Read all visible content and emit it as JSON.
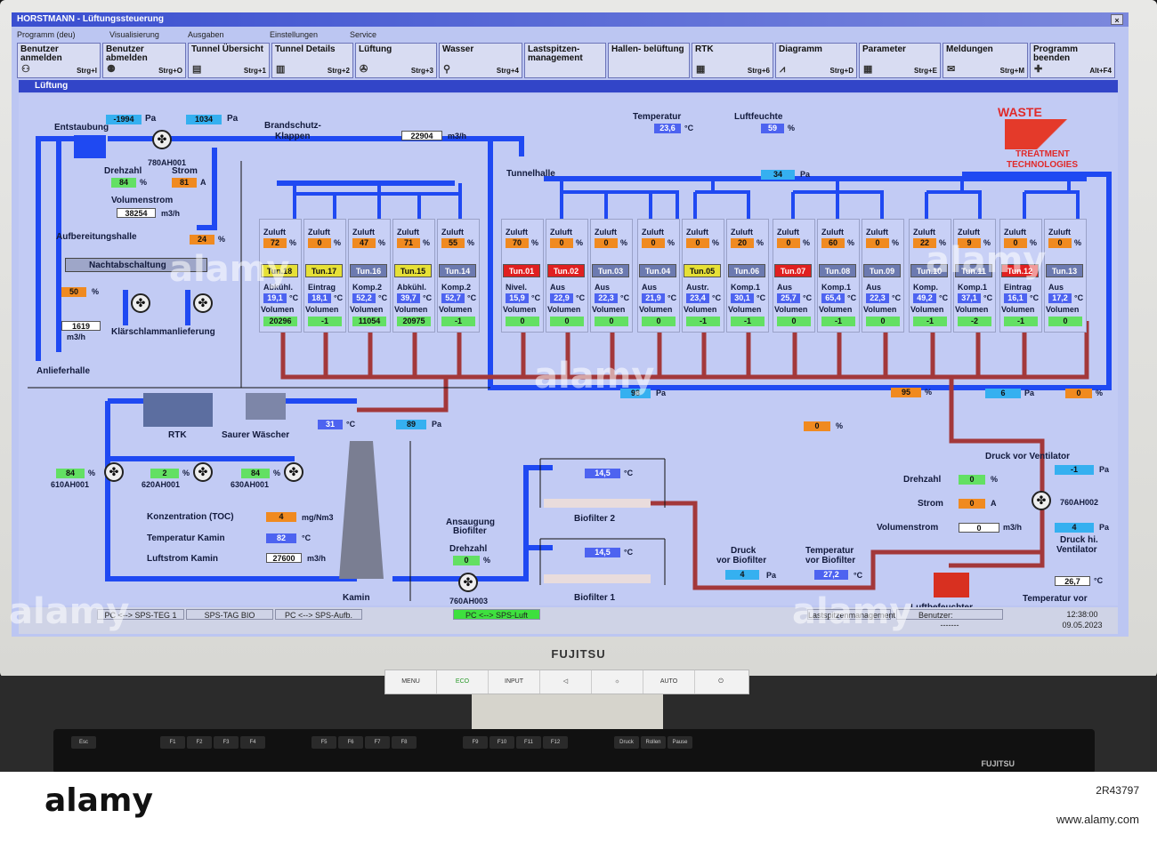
{
  "window": {
    "title": "HORSTMANN - Lüftungssteuerung",
    "close_symbol": "×"
  },
  "menu": [
    "Programm (deu)",
    "Visualisierung",
    "Ausgaben",
    "Einstellungen",
    "Service"
  ],
  "toolbar": [
    {
      "label": "Benutzer anmelden",
      "hotkey": "Strg+I"
    },
    {
      "label": "Benutzer abmelden",
      "hotkey": "Strg+O"
    },
    {
      "label": "Tunnel Übersicht",
      "hotkey": "Strg+1"
    },
    {
      "label": "Tunnel Details",
      "hotkey": "Strg+2"
    },
    {
      "label": "Lüftung",
      "hotkey": "Strg+3"
    },
    {
      "label": "Wasser",
      "hotkey": "Strg+4"
    },
    {
      "label": "Lastspitzen- management",
      "hotkey": ""
    },
    {
      "label": "Hallen- belüftung",
      "hotkey": ""
    },
    {
      "label": "RTK",
      "hotkey": "Strg+6"
    },
    {
      "label": "Diagramm",
      "hotkey": "Strg+D"
    },
    {
      "label": "Parameter",
      "hotkey": "Strg+E"
    },
    {
      "label": "Meldungen",
      "hotkey": "Strg+M"
    },
    {
      "label": "Programm beenden",
      "hotkey": "Alt+F4"
    }
  ],
  "section": "Lüftung",
  "logo": {
    "name": "WASTE",
    "line1": "TREATMENT",
    "line2": "TECHNOLOGIES"
  },
  "left": {
    "p1": "-1994",
    "p2": "1034",
    "pa": "Pa",
    "entstaubung": "Entstaubung",
    "fan": "780AH001",
    "drehzahl": "Drehzahl",
    "strom": "Strom",
    "drehzahl_val": "84",
    "strom_val": "81",
    "pct": "%",
    "amp": "A",
    "volumenstrom": "Volumenstrom",
    "vol_val": "38254",
    "m3h": "m3/h",
    "aufbereitung": "Aufbereitungshalle",
    "auf_val": "24",
    "nacht": "Nachtabschaltung",
    "v50": "50",
    "v1619": "1619",
    "klaer": "Klärschlammanlieferung",
    "anliefer": "Anlieferhalle"
  },
  "top": {
    "brand": "Brandschutz-",
    "klappen": "Klappen",
    "flow": "22904",
    "m3h": "m3/h",
    "tunnelhalle": "Tunnelhalle",
    "temp_label": "Temperatur",
    "temp_val": "23,6",
    "degc": "°C",
    "hum_label": "Luftfeuchte",
    "hum_val": "59",
    "pct": "%",
    "p34": "34",
    "pa": "Pa"
  },
  "tunnels": [
    {
      "zuluft": "72",
      "name": "Tun.18",
      "status": "Abkühl.",
      "temp": "19,1",
      "vol": "20296",
      "color": "y"
    },
    {
      "zuluft": "0",
      "name": "Tun.17",
      "status": "Eintrag",
      "temp": "18,1",
      "vol": "-1",
      "color": "y"
    },
    {
      "zuluft": "47",
      "name": "Tun.16",
      "status": "Komp.2",
      "temp": "52,2",
      "vol": "11054",
      "color": "g"
    },
    {
      "zuluft": "71",
      "name": "Tun.15",
      "status": "Abkühl.",
      "temp": "39,7",
      "vol": "20975",
      "color": "y"
    },
    {
      "zuluft": "55",
      "name": "Tun.14",
      "status": "Komp.2",
      "temp": "52,7",
      "vol": "-1",
      "color": "g"
    },
    {
      "zuluft": "70",
      "name": "Tun.01",
      "status": "Nivel.",
      "temp": "15,9",
      "vol": "0",
      "color": "r"
    },
    {
      "zuluft": "0",
      "name": "Tun.02",
      "status": "Aus",
      "temp": "22,9",
      "vol": "0",
      "color": "r"
    },
    {
      "zuluft": "0",
      "name": "Tun.03",
      "status": "Aus",
      "temp": "22,3",
      "vol": "0",
      "color": "g"
    },
    {
      "zuluft": "0",
      "name": "Tun.04",
      "status": "Aus",
      "temp": "21,9",
      "vol": "0",
      "color": "g"
    },
    {
      "zuluft": "0",
      "name": "Tun.05",
      "status": "Austr.",
      "temp": "23,4",
      "vol": "-1",
      "color": "y"
    },
    {
      "zuluft": "20",
      "name": "Tun.06",
      "status": "Komp.1",
      "temp": "30,1",
      "vol": "-1",
      "color": "g"
    },
    {
      "zuluft": "0",
      "name": "Tun.07",
      "status": "Aus",
      "temp": "25,7",
      "vol": "0",
      "color": "r"
    },
    {
      "zuluft": "60",
      "name": "Tun.08",
      "status": "Komp.1",
      "temp": "65,4",
      "vol": "-1",
      "color": "g"
    },
    {
      "zuluft": "0",
      "name": "Tun.09",
      "status": "Aus",
      "temp": "22,3",
      "vol": "0",
      "color": "g"
    },
    {
      "zuluft": "22",
      "name": "Tun.10",
      "status": "Komp.",
      "temp": "49,2",
      "vol": "-1",
      "color": "g"
    },
    {
      "zuluft": "9",
      "name": "Tun.11",
      "status": "Komp.1",
      "temp": "37,1",
      "vol": "-2",
      "color": "g"
    },
    {
      "zuluft": "0",
      "name": "Tun.12",
      "status": "Eintrag",
      "temp": "16,1",
      "vol": "-1",
      "color": "r"
    },
    {
      "zuluft": "0",
      "name": "Tun.13",
      "status": "Aus",
      "temp": "17,2",
      "vol": "0",
      "color": "g"
    }
  ],
  "tunnel_labels": {
    "zuluft": "Zuluft",
    "pct": "%",
    "degc": "°C",
    "volumen": "Volumen"
  },
  "mid": {
    "p98": "98",
    "p95": "95",
    "p6": "6",
    "p0": "0",
    "pz0": "0",
    "pa": "Pa",
    "pct": "%",
    "rtk": "RTK",
    "saurer": "Saurer Wäscher",
    "t31": "31",
    "degc": "°C",
    "p89": "89"
  },
  "bottom_left": {
    "f1": "610AH001",
    "f2": "620AH001",
    "f3": "630AH001",
    "v1": "84",
    "v2": "2",
    "v3": "84",
    "pct": "%",
    "toc_label": "Konzentration (TOC)",
    "toc_val": "4",
    "toc_unit": "mg/Nm3",
    "tk_label": "Temperatur Kamin",
    "tk_val": "82",
    "degc": "°C",
    "lk_label": "Luftstrom Kamin",
    "lk_val": "27600",
    "m3h": "m3/h",
    "kamin": "Kamin"
  },
  "biofilter": {
    "ansaugung": "Ansaugung",
    "biofilter": "Biofilter",
    "drehzahl": "Drehzahl",
    "dz_val": "0",
    "pct": "%",
    "fan": "760AH003",
    "bf2": "Biofilter 2",
    "bf1": "Biofilter 1",
    "t2": "14,5",
    "t1": "14,5",
    "degc": "°C"
  },
  "right": {
    "druck_vor_vent": "Druck vor Ventilator",
    "dvv_val": "-1",
    "pa": "Pa",
    "drehzahl": "Drehzahl",
    "dz_val": "0",
    "pct": "%",
    "strom": "Strom",
    "strom_val": "0",
    "amp": "A",
    "volstrom": "Volumenstrom",
    "vs_val": "0",
    "m3h": "m3/h",
    "fan": "760AH002",
    "p4": "4",
    "druck_hi": "Druck hi.",
    "ventilator": "Ventilator",
    "druck_vor_bio": "Druck",
    "vor_bio": "vor Biofilter",
    "dvb_val": "4",
    "temp_vor_bio": "Temperatur",
    "tvb_val": "27,2",
    "degc": "°C",
    "t_befeuchter": "26,7",
    "luftbefeuchter": "Luftbefeuchter",
    "temp_vor_lb": "Temperatur vor",
    "lb": "Luftbefeuchter"
  },
  "status": {
    "s1": "PC <--> SPS-TEG 1",
    "s2": "SPS-TAG BIO",
    "s3": "PC <--> SPS-Aufb.",
    "s4": "PC <--> SPS-Luft",
    "benutzer": "Benutzer:",
    "user": "-------",
    "time": "12:38:00",
    "date": "09.05.2023",
    "mgmt": "Lastspitzenmanagement"
  },
  "monitor": {
    "brand": "FUJITSU",
    "buttons": [
      "MENU",
      "ECO",
      "INPUT",
      "◁",
      "☼",
      "AUTO",
      "⏻"
    ]
  },
  "keyboard": {
    "brand": "FUJITSU",
    "keys": [
      "Esc",
      "F1",
      "F2",
      "F3",
      "F4",
      "F5",
      "F6",
      "F7",
      "F8",
      "F9",
      "F10",
      "F11",
      "F12",
      "Druck",
      "Rollen",
      "Pause"
    ]
  },
  "stock": {
    "logo": "alamy",
    "id": "2R43797",
    "url": "www.alamy.com"
  }
}
